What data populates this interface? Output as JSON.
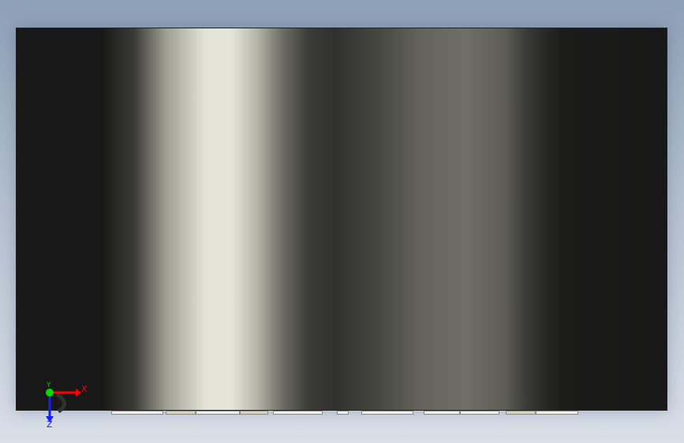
{
  "viewport": {
    "triad": {
      "x_label": "X",
      "y_label": "Y",
      "z_label": "Z",
      "x_color": "#ff0000",
      "y_color": "#00cc00",
      "z_color": "#1a1aff"
    }
  }
}
